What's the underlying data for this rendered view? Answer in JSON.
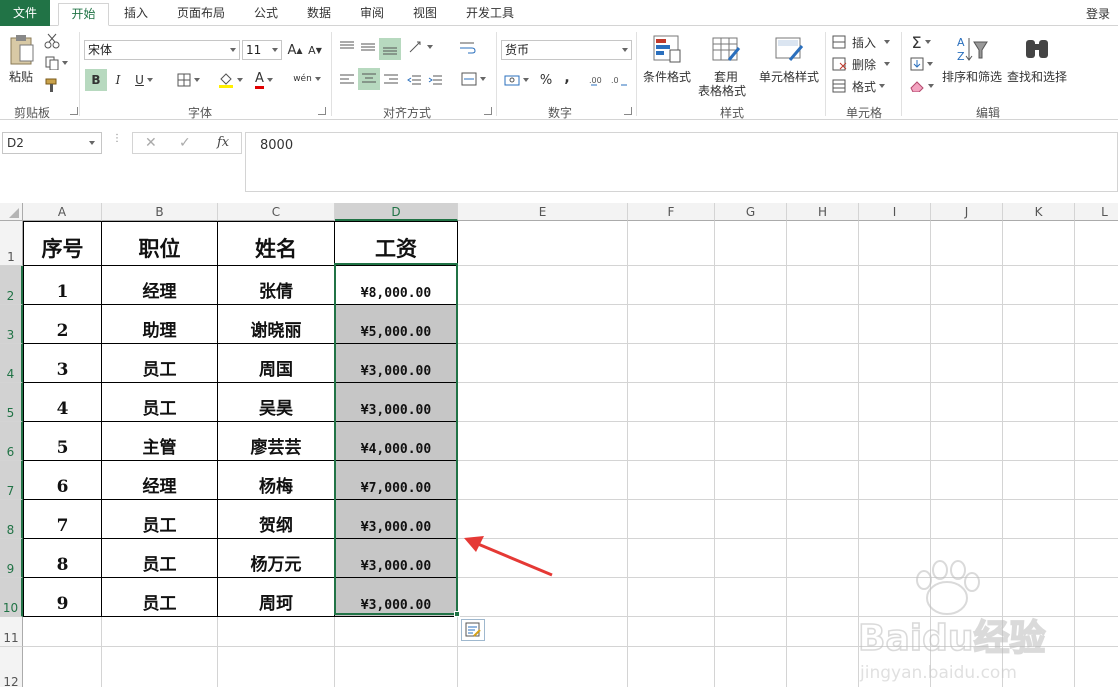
{
  "tabs": [
    {
      "label": "文件",
      "name": "tab-file"
    },
    {
      "label": "开始",
      "name": "tab-home"
    },
    {
      "label": "插入",
      "name": "tab-insert"
    },
    {
      "label": "页面布局",
      "name": "tab-page-layout"
    },
    {
      "label": "公式",
      "name": "tab-formulas"
    },
    {
      "label": "数据",
      "name": "tab-data"
    },
    {
      "label": "审阅",
      "name": "tab-review"
    },
    {
      "label": "视图",
      "name": "tab-view"
    },
    {
      "label": "开发工具",
      "name": "tab-developer"
    }
  ],
  "login": "登录",
  "ribbon": {
    "clipboard": {
      "paste": "粘贴",
      "group": "剪贴板"
    },
    "font": {
      "name": "宋体",
      "size": "11",
      "grow": "A",
      "shrink": "A",
      "bold": "B",
      "italic": "I",
      "underline": "U",
      "color_letter": "A",
      "phonetic": "wén",
      "group": "字体"
    },
    "alignment": {
      "group": "对齐方式"
    },
    "number": {
      "format": "货币",
      "percent": "%",
      "comma": ",",
      "group": "数字"
    },
    "styles": {
      "conditional": "条件格式",
      "table_line1": "套用",
      "table_line2": "表格格式",
      "cell_styles": "单元格样式",
      "group": "样式"
    },
    "cells": {
      "insert": "插入",
      "delete": "删除",
      "format": "格式",
      "group": "单元格"
    },
    "editing": {
      "sort": "排序和筛选",
      "find": "查找和选择",
      "group": "编辑"
    }
  },
  "formula_bar": {
    "name_box": "D2",
    "fx": "fx",
    "value": "8000"
  },
  "sheet": {
    "columns": [
      "A",
      "B",
      "C",
      "D",
      "E",
      "F",
      "G",
      "H",
      "I",
      "J",
      "K",
      "L"
    ],
    "rows": [
      "1",
      "2",
      "3",
      "4",
      "5",
      "6",
      "7",
      "8",
      "9",
      "10",
      "11",
      "12"
    ],
    "header": [
      "序号",
      "职位",
      "姓名",
      "工资"
    ],
    "data": [
      [
        "1",
        "经理",
        "张倩",
        "¥8,000.00"
      ],
      [
        "2",
        "助理",
        "谢晓丽",
        "¥5,000.00"
      ],
      [
        "3",
        "员工",
        "周国",
        "¥3,000.00"
      ],
      [
        "4",
        "员工",
        "吴昊",
        "¥3,000.00"
      ],
      [
        "5",
        "主管",
        "廖芸芸",
        "¥4,000.00"
      ],
      [
        "6",
        "经理",
        "杨梅",
        "¥7,000.00"
      ],
      [
        "7",
        "员工",
        "贺纲",
        "¥3,000.00"
      ],
      [
        "8",
        "员工",
        "杨万元",
        "¥3,000.00"
      ],
      [
        "9",
        "员工",
        "周珂",
        "¥3,000.00"
      ]
    ]
  },
  "colors": {
    "accent": "#217346",
    "selection_fill": "#c6c6c6",
    "annotation_arrow": "#e53935"
  },
  "watermark": {
    "brand": "Baidu经验",
    "url": "jingyan.baidu.com"
  }
}
